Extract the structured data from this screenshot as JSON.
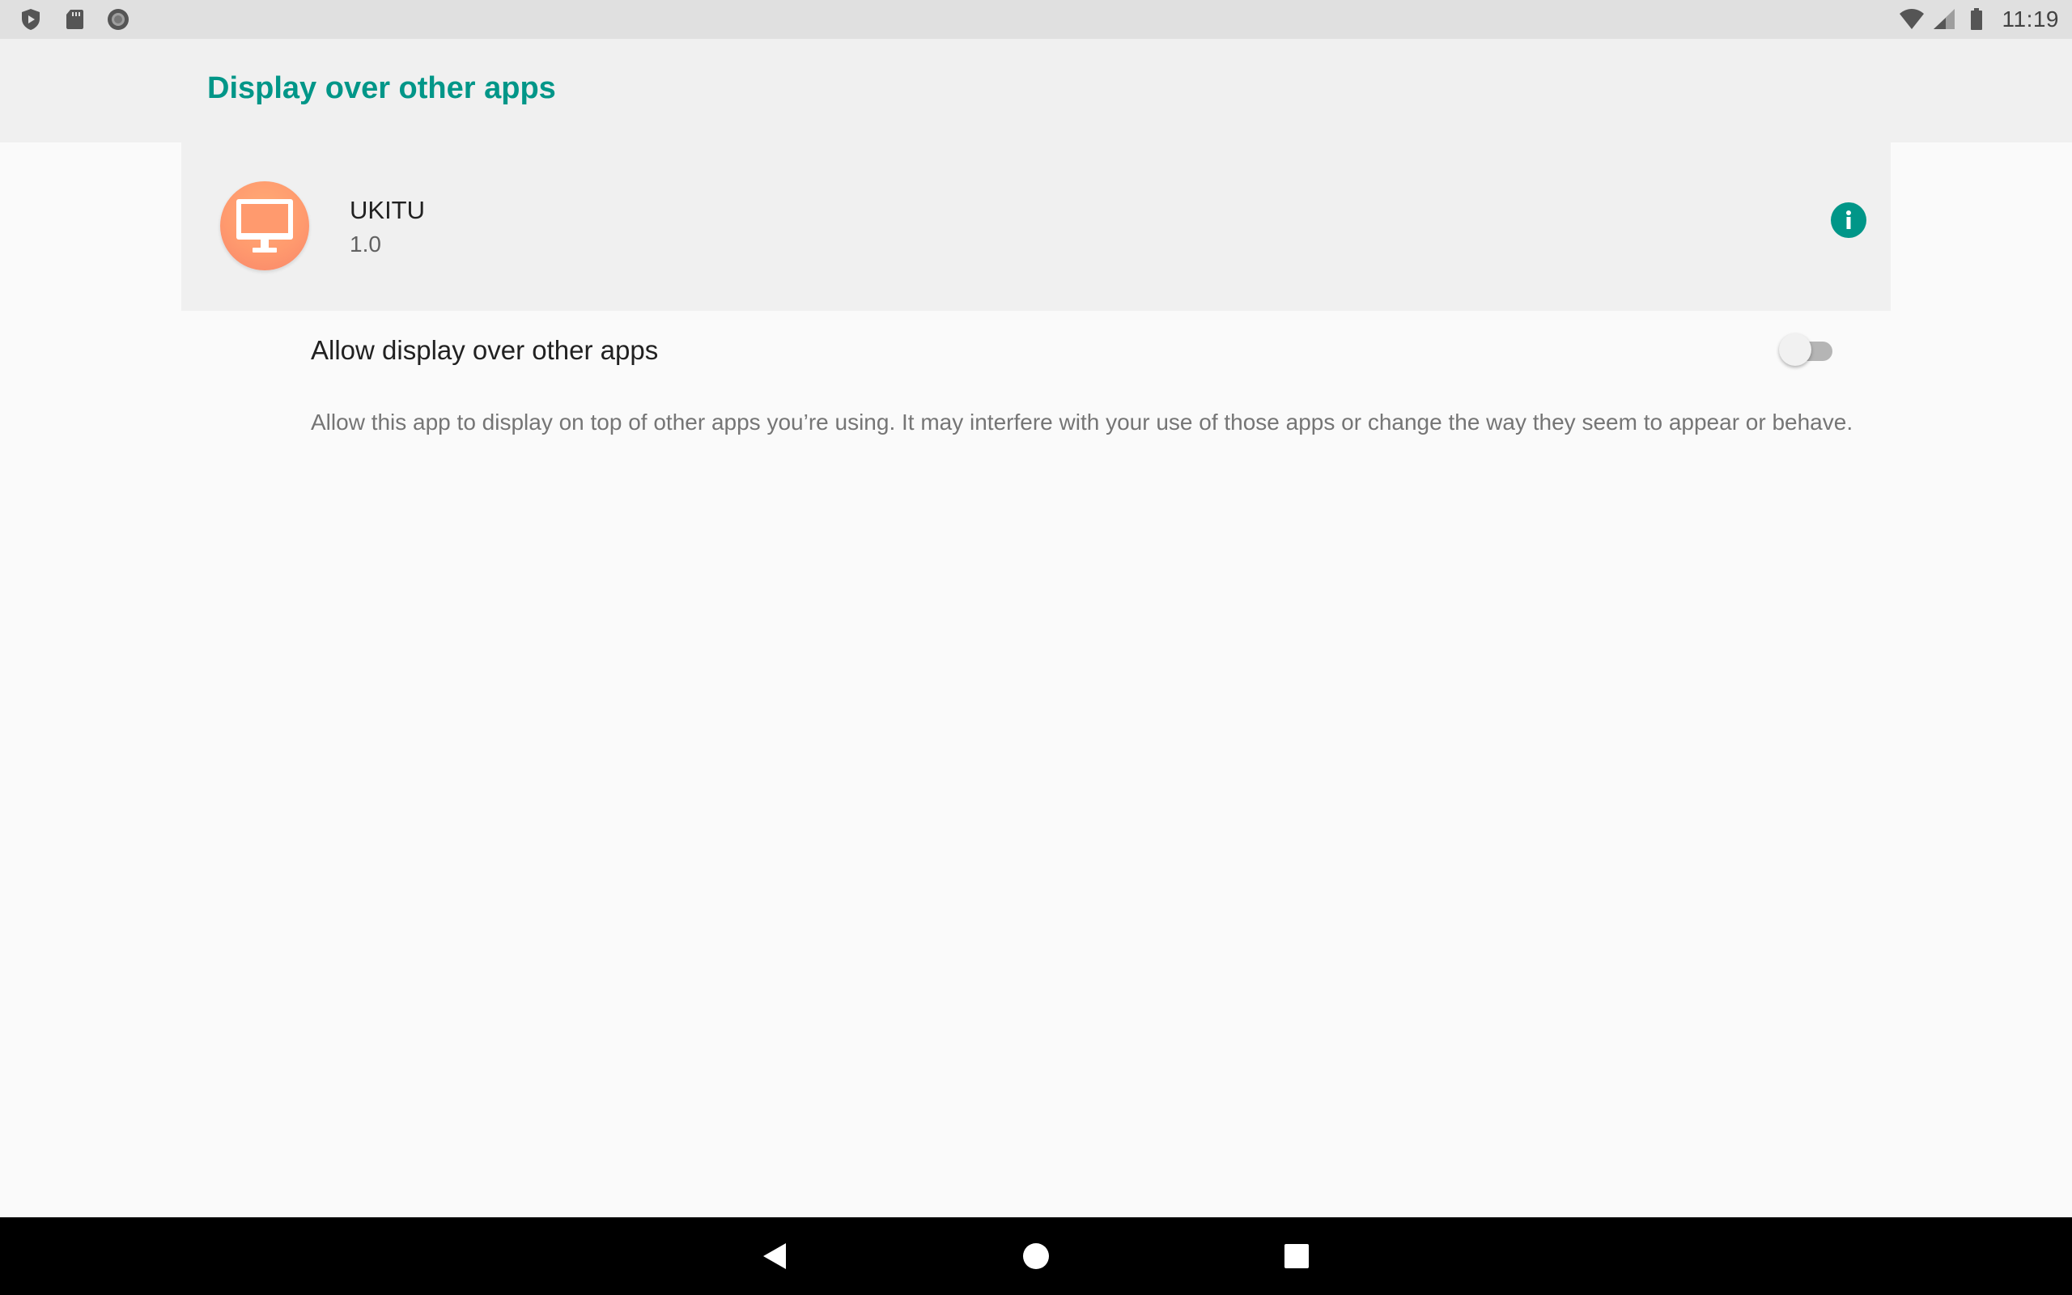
{
  "status_bar": {
    "time": "11:19",
    "left_icons": [
      "shield-play-icon",
      "sd-card-icon",
      "record-icon"
    ],
    "right_icons": [
      "wifi-icon",
      "cell-signal-icon",
      "battery-icon"
    ]
  },
  "app_bar": {
    "title": "Display over other apps"
  },
  "app_info": {
    "name": "UKITU",
    "version": "1.0",
    "icon": "monitor-icon",
    "info_icon": "info-icon"
  },
  "preference": {
    "title": "Allow display over other apps",
    "summary": "Allow this app to display on top of other apps you’re using. It may interfere with your use of those apps or change the way they seem to appear or behave.",
    "switch_on": false
  },
  "nav_bar": {
    "buttons": [
      "back-icon",
      "home-icon",
      "recents-icon"
    ]
  },
  "colors": {
    "accent": "#009688",
    "app_icon": "#ff9a6e"
  }
}
